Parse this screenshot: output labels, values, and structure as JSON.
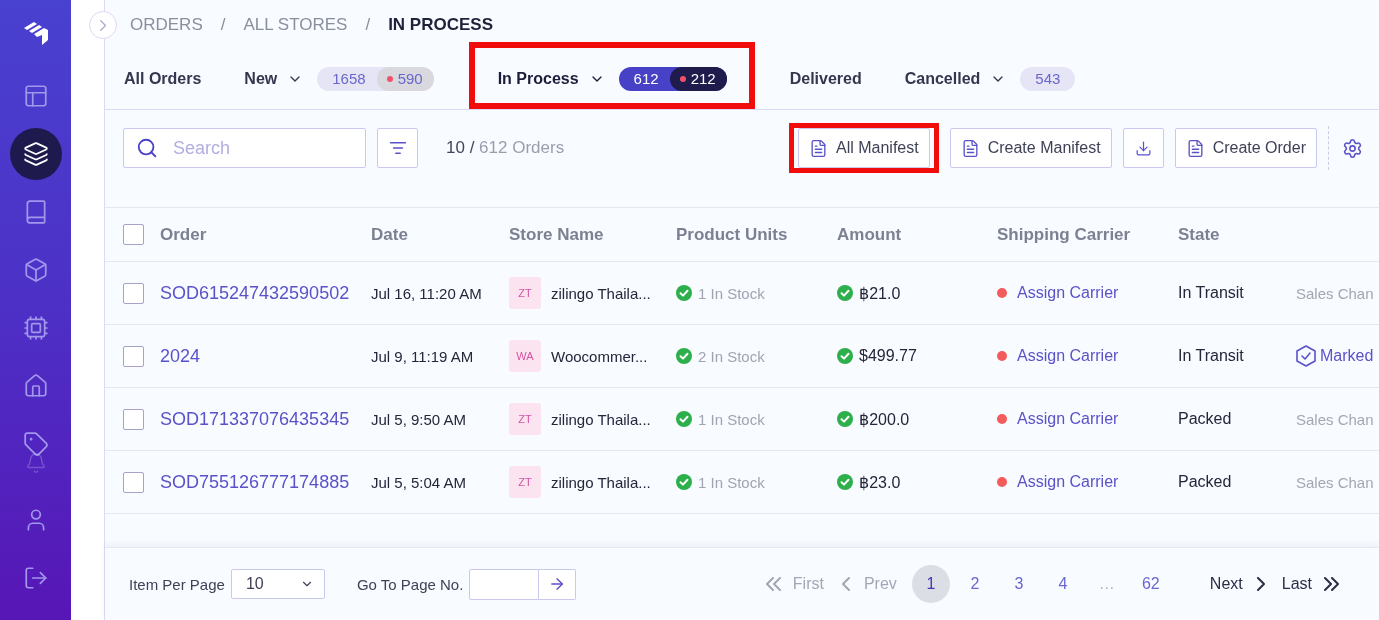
{
  "sidebar": {
    "items": [
      {
        "selected": false
      },
      {
        "selected": true
      },
      {
        "selected": false
      },
      {
        "selected": false
      },
      {
        "selected": false
      },
      {
        "selected": false
      },
      {
        "selected": false
      },
      {
        "selected": false
      },
      {
        "selected": false
      }
    ]
  },
  "breadcrumb": [
    {
      "kind": "link",
      "text": "ORDERS"
    },
    {
      "kind": "separator",
      "text": "/"
    },
    {
      "kind": "link",
      "text": "ALL STORES"
    },
    {
      "kind": "separator",
      "text": "/"
    },
    {
      "kind": "current",
      "text": "IN PROCESS"
    }
  ],
  "tabs": [
    {
      "label": "All Orders",
      "selected": false,
      "dropdown": false,
      "highlighted": false
    },
    {
      "label": "New",
      "selected": false,
      "dropdown": true,
      "highlighted": false,
      "count": "1658",
      "alert_count": "590"
    },
    {
      "label": "In Process",
      "selected": true,
      "dropdown": true,
      "highlighted": true,
      "count": "612",
      "alert_count": "212"
    },
    {
      "label": "Delivered",
      "selected": false,
      "dropdown": false,
      "highlighted": false
    },
    {
      "label": "Cancelled",
      "selected": false,
      "dropdown": true,
      "highlighted": false,
      "count": "543"
    }
  ],
  "toolbar": {
    "search": {
      "placeholder": "Search"
    },
    "shown": "10 /",
    "total": "612 Orders",
    "buttons": [
      {
        "kind": "document",
        "label": "All Manifest",
        "highlighted": true
      },
      {
        "kind": "document",
        "label": "Create Manifest",
        "highlighted": false
      },
      {
        "kind": "download",
        "highlighted": false
      },
      {
        "kind": "document",
        "label": "Create Order",
        "highlighted": false
      },
      {
        "kind": "settings",
        "highlighted": false
      }
    ]
  },
  "table": {
    "select_all": {
      "checked": false
    },
    "columns": [
      "Order",
      "Date",
      "Store Name",
      "Product Units",
      "Amount",
      "Shipping Carrier",
      "State"
    ],
    "rows": [
      {
        "checked": false,
        "order": "SOD615247432590502",
        "date": "Jul 16, 11:20 AM",
        "store": {
          "initials": "ZT",
          "name": "zilingo Thaila..."
        },
        "units": "1 In Stock",
        "amount": "฿21.0",
        "carrier": "Assign Carrier",
        "state": "In Transit",
        "column_9": {
          "kind": "text",
          "text": "Sales Chan"
        }
      },
      {
        "checked": false,
        "order": "2024",
        "date": "Jul 9, 11:19 AM",
        "store": {
          "initials": "WA",
          "name": "Woocommer..."
        },
        "units": "2 In Stock",
        "amount": "$499.77",
        "carrier": "Assign Carrier",
        "state": "In Transit",
        "column_9": {
          "kind": "verified",
          "text": "Marked"
        }
      },
      {
        "checked": false,
        "order": "SOD171337076435345",
        "date": "Jul 5, 9:50 AM",
        "store": {
          "initials": "ZT",
          "name": "zilingo Thaila..."
        },
        "units": "1 In Stock",
        "amount": "฿200.0",
        "carrier": "Assign Carrier",
        "state": "Packed",
        "column_9": {
          "kind": "text",
          "text": "Sales Chan"
        }
      },
      {
        "checked": false,
        "order": "SOD755126777174885",
        "date": "Jul 5, 5:04 AM",
        "store": {
          "initials": "ZT",
          "name": "zilingo Thaila..."
        },
        "units": "1 In Stock",
        "amount": "฿23.0",
        "carrier": "Assign Carrier",
        "state": "Packed",
        "column_9": {
          "kind": "text",
          "text": "Sales Chan"
        }
      }
    ]
  },
  "footer": {
    "per_page_label": "Item Per Page",
    "per_page_value": "10",
    "goto_label": "Go To Page No.",
    "pagination": {
      "first": {
        "label": "First",
        "disabled": true
      },
      "prev": {
        "label": "Prev",
        "disabled": true
      },
      "pages": [
        {
          "kind": "page",
          "label": "1",
          "selected": true
        },
        {
          "kind": "page",
          "label": "2",
          "selected": false
        },
        {
          "kind": "page",
          "label": "3",
          "selected": false
        },
        {
          "kind": "page",
          "label": "4",
          "selected": false
        },
        {
          "kind": "gap",
          "label": "…"
        },
        {
          "kind": "page",
          "label": "62",
          "selected": false
        }
      ],
      "next": {
        "label": "Next",
        "disabled": false
      },
      "last": {
        "label": "Last",
        "disabled": false
      }
    }
  }
}
